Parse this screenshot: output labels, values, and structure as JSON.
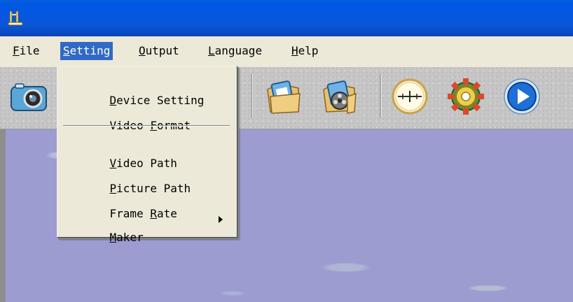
{
  "title_bar": {
    "title": ""
  },
  "menubar": {
    "items": [
      {
        "pre": "",
        "ul": "F",
        "post": "ile"
      },
      {
        "pre": "",
        "ul": "S",
        "post": "etting"
      },
      {
        "pre": "",
        "ul": "O",
        "post": "utput"
      },
      {
        "pre": "",
        "ul": "L",
        "post": "anguage"
      },
      {
        "pre": "",
        "ul": "H",
        "post": "elp"
      }
    ],
    "open_index": 1
  },
  "setting_menu": {
    "items": [
      {
        "pre": "",
        "ul": "D",
        "post": "evice Setting"
      },
      {
        "pre": "Video ",
        "ul": "F",
        "post": "ormat"
      },
      {
        "pre": "",
        "ul": "V",
        "post": "ideo Path"
      },
      {
        "pre": "",
        "ul": "P",
        "post": "icture Path"
      },
      {
        "pre": "Frame ",
        "ul": "R",
        "post": "ate"
      },
      {
        "pre": "",
        "ul": "M",
        "post": "aker"
      }
    ]
  },
  "toolbar": {
    "buttons": [
      "camera-icon",
      "folder-picture-icon",
      "folder-video-icon",
      "crosshair-icon",
      "gear-icon",
      "play-icon"
    ]
  },
  "colors": {
    "title_bar": "#0a56d8",
    "menu_highlight": "#316ac5",
    "video_background": "#9c9cd0",
    "window_face": "#ece9d8"
  }
}
